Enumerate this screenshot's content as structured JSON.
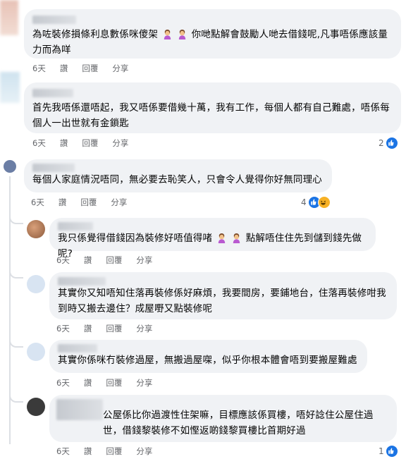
{
  "comments": [
    {
      "text": "為咗裝修損條利息數係咪傻架 🤷‍♀️ 🤷‍♀️ 你咁點解會鼓勵人哋去借錢呢,凡事唔係應該量力而為咩",
      "part1": "為咗裝修損條利息數係咪傻架",
      "part2": "你哋點解會鼓勵人哋去借錢呢,凡事唔係應該量力而為咩",
      "time": "6天",
      "like": "讚",
      "reply": "回覆",
      "share": "分享"
    },
    {
      "text": "首先我唔係還唔起，我又唔係要借幾十萬，我有工作，每個人都有自己難處，唔係每個人一出世就有金鎖匙",
      "time": "6天",
      "like": "讚",
      "reply": "回覆",
      "share": "分享",
      "reaction_count": "2"
    },
    {
      "text": "每個人家庭情況唔同，無必要去恥笑人，只會令人覺得你好無同理心",
      "time": "6天",
      "like": "讚",
      "reply": "回覆",
      "share": "分享",
      "reaction_count": "4"
    },
    {
      "part1": "我只係覺得借錢因為裝修好唔值得啫",
      "part2": "點解唔住住先到儲到錢先做呢?",
      "time": "6天",
      "like": "讚",
      "reply": "回覆",
      "share": "分享"
    },
    {
      "text": "其實你又知唔知住落再裝修係好麻煩，我要間房，要鋪地台，住落再裝修咁我到時又搬去邊住？成屋嘢又點裝修呢",
      "time": "6天",
      "like": "讚",
      "reply": "回覆",
      "share": "分享"
    },
    {
      "text": "其實你係咪冇裝修過屋，無搬過屋㗎，似乎你根本體會唔到要搬屋難處",
      "time": "6天",
      "like": "讚",
      "reply": "回覆",
      "share": "分享"
    },
    {
      "text": "公屋係比你過渡性住架嘛，目標應該係買樓，唔好諗住公屋住過世，借錢黎裝修不如慳返啲錢黎買樓比首期好過",
      "time": "6天",
      "like": "讚",
      "reply": "回覆",
      "share": "分享",
      "reaction_count": "1"
    }
  ],
  "colors": {
    "bubble": "#f0f2f5",
    "meta": "#65676b",
    "like_blue": "#1b74e4",
    "haha_yellow": "#f7b125"
  },
  "icons": [
    "avatar",
    "shrug-emoji",
    "like-reaction-icon",
    "haha-reaction-icon"
  ]
}
